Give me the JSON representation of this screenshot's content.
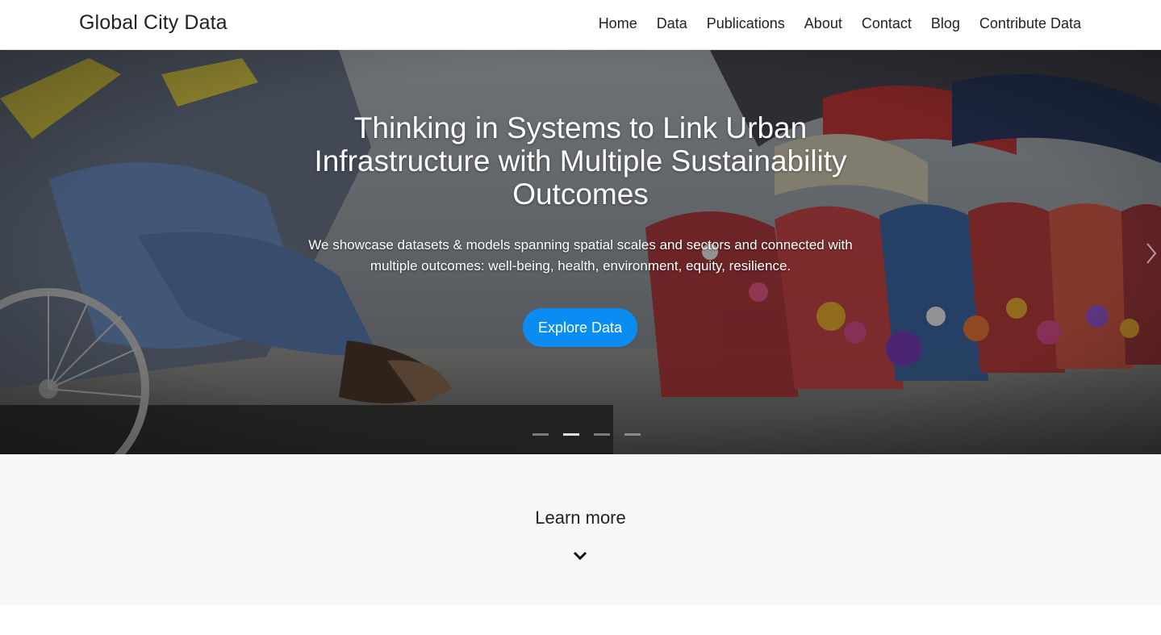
{
  "header": {
    "brand": "Global City Data",
    "nav": [
      {
        "label": "Home"
      },
      {
        "label": "Data"
      },
      {
        "label": "Publications"
      },
      {
        "label": "About"
      },
      {
        "label": "Contact"
      },
      {
        "label": "Blog"
      },
      {
        "label": "Contribute Data"
      }
    ]
  },
  "hero": {
    "title": "Thinking in Systems to Link Urban Infrastructure with Multiple Sustainability Outcomes",
    "subtitle": "We showcase datasets & models spanning spatial scales and sectors and connected with multiple outcomes: well-being, health, environment, equity, resilience.",
    "cta_label": "Explore Data",
    "cta_color": "#0a8df2",
    "indicator_count": 4,
    "active_indicator": 2,
    "next_icon": "chevron-right-icon"
  },
  "learn_more": {
    "label": "Learn more",
    "icon": "chevron-down-icon"
  }
}
